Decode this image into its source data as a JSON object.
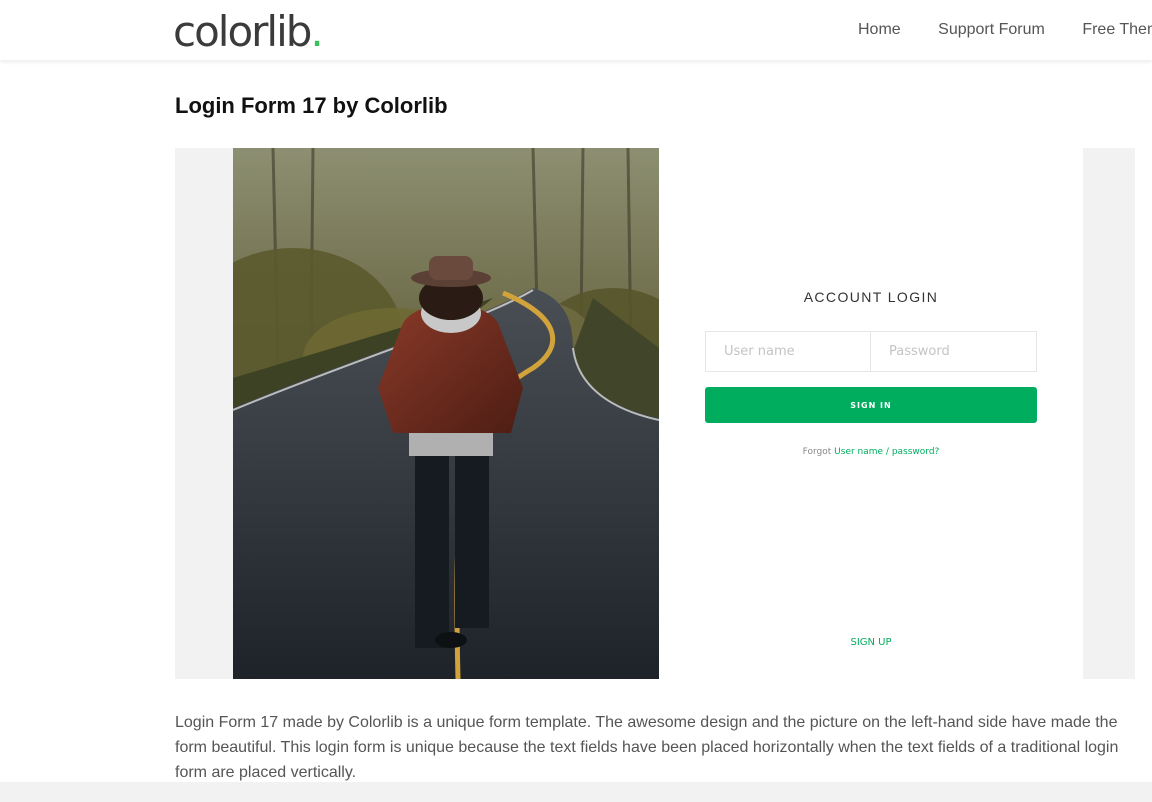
{
  "header": {
    "logo_text": "colorlib",
    "logo_dot": ".",
    "nav": [
      "Home",
      "Support Forum",
      "Free Theme"
    ]
  },
  "page": {
    "title": "Login Form 17 by Colorlib",
    "description": "Login Form 17 made by Colorlib is a unique form template. The awesome design and the picture on the left-hand side have made the form beautiful. This login form is unique because the text fields have been placed horizontally when the text fields of a traditional login form are placed vertically."
  },
  "login": {
    "title": "ACCOUNT LOGIN",
    "username_placeholder": "User name",
    "password_placeholder": "Password",
    "signin_label": "SIGN IN",
    "forgot_prefix": "Forgot",
    "forgot_link": "User name / password?",
    "signup_label": "SIGN UP"
  },
  "colors": {
    "accent": "#00ad5f",
    "logo_dot": "#3bbf5a",
    "panel_bg": "#f2f2f2"
  },
  "image": {
    "icon": "road-hiker-photo"
  }
}
